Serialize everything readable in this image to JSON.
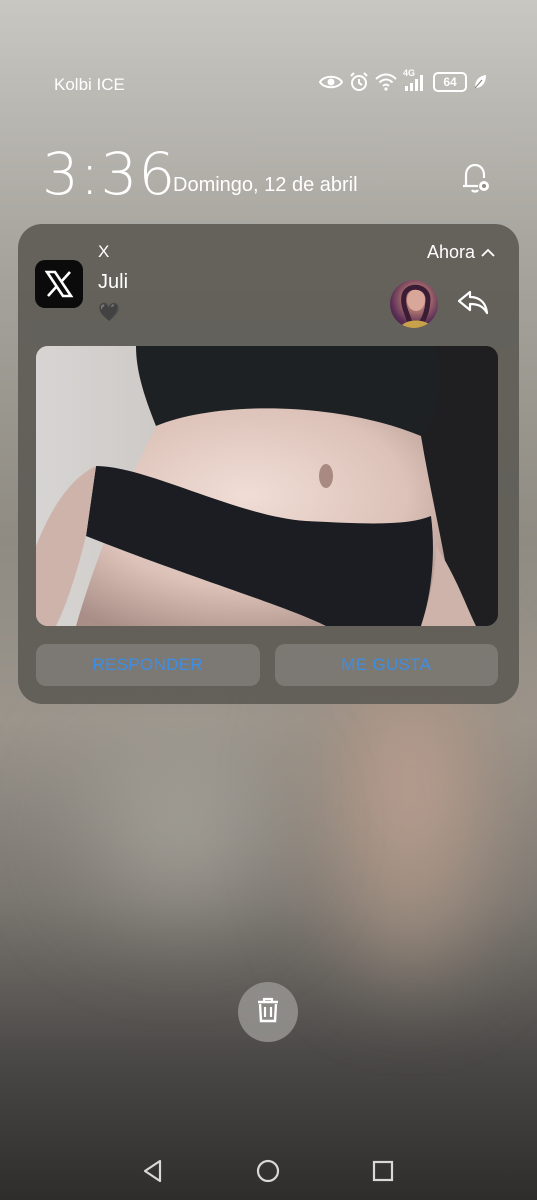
{
  "status_bar": {
    "carrier": "Kolbi ICE",
    "network": "4G",
    "battery": "64"
  },
  "lock": {
    "time": "3:36",
    "date": "Domingo, 12 de abril"
  },
  "notification": {
    "app_name": "X",
    "time": "Ahora",
    "title": "Juli",
    "body": "🖤",
    "actions": {
      "reply": "RESPONDER",
      "like": "ME GUSTA"
    }
  },
  "colors": {
    "action_text": "#3d8ee6",
    "card_bg": "#5f5c56"
  }
}
